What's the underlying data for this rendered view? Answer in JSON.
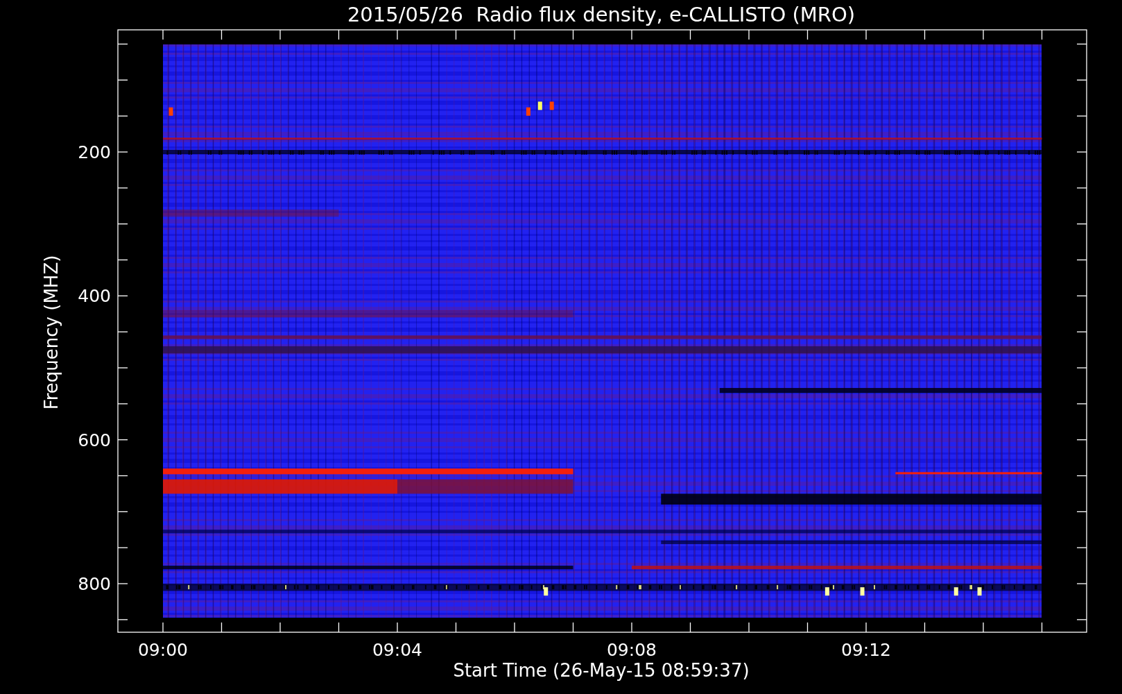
{
  "title": "2015/05/26  Radio flux density, e-CALLISTO (MRO)",
  "plot": {
    "ylabel": "Frequency (MHZ)",
    "xlabel": "Start Time (26-May-15 08:59:37)",
    "yticks": [
      "200",
      "400",
      "600",
      "800"
    ],
    "xticks": [
      "09:00",
      "09:04",
      "09:08",
      "09:12"
    ]
  }
}
